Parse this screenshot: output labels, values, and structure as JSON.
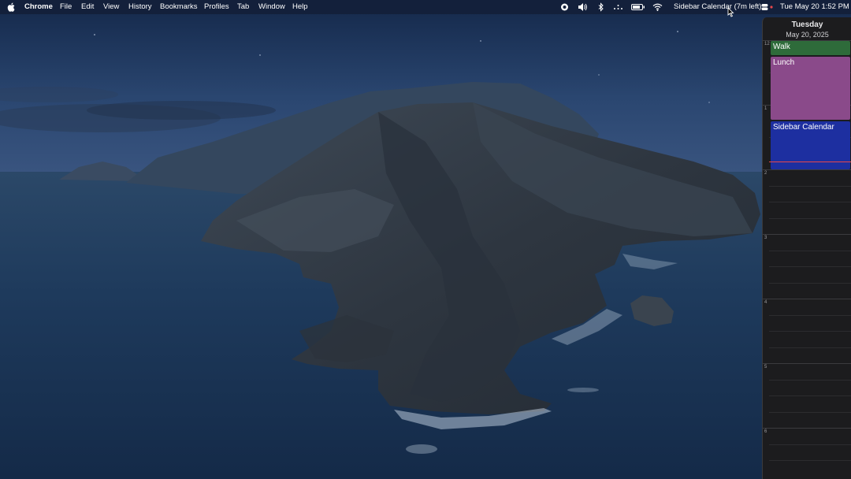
{
  "menubar": {
    "apple_icon": "apple-logo-icon",
    "app_name": "Chrome",
    "menus": [
      "File",
      "Edit",
      "View",
      "History",
      "Bookmarks",
      "Profiles",
      "Tab",
      "Window",
      "Help"
    ],
    "status": {
      "calendar_status": "Sidebar Calendar (7m left)",
      "clock": "Tue May 20  1:52 PM",
      "icons": [
        "record-icon",
        "volume-icon",
        "bluetooth-icon",
        "dots-icon",
        "battery-icon",
        "wifi-icon",
        "control-center-icon"
      ]
    }
  },
  "calendar": {
    "weekday": "Tuesday",
    "date": "May 20, 2025",
    "hours": [
      "12",
      "1",
      "2",
      "3",
      "4",
      "5",
      "6"
    ],
    "events": [
      {
        "title": "Walk",
        "color": "#2e6b3a"
      },
      {
        "title": "Lunch",
        "color": "#8a4a8a"
      },
      {
        "title": "Sidebar Calendar",
        "color": "#1d2fa0"
      }
    ],
    "now_indicator_color": "#e8474c"
  },
  "wallpaper": "macOS Catalina island at night"
}
